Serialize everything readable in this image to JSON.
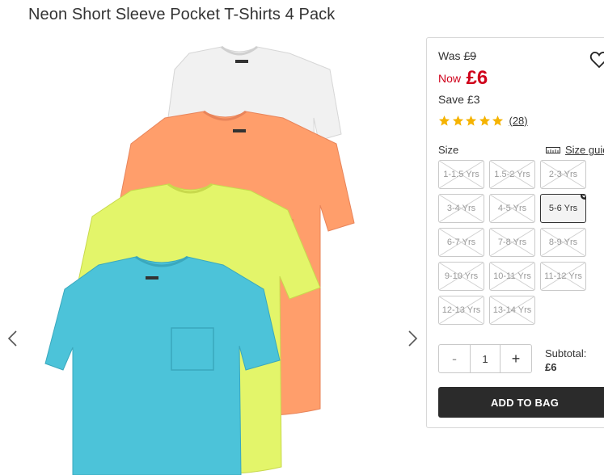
{
  "product": {
    "title": "Neon Short Sleeve Pocket T-Shirts 4 Pack"
  },
  "gallery": {
    "prev_icon": "chevron-left-icon",
    "next_icon": "chevron-right-icon",
    "shirt_colors": [
      "#f2f2f2",
      "#ff9e6b",
      "#e3f56a",
      "#4cc3d9"
    ]
  },
  "price": {
    "was_label": "Was",
    "was_value": "£9",
    "now_label": "Now",
    "now_value": "£6",
    "save_label": "Save",
    "save_value": "£3"
  },
  "rating": {
    "stars": 5,
    "count": "(28)"
  },
  "sizes": {
    "label": "Size",
    "guide_label": "Size guid",
    "options": [
      {
        "label": "1-1.5 Yrs",
        "available": false,
        "selected": false
      },
      {
        "label": "1.5-2 Yrs",
        "available": false,
        "selected": false
      },
      {
        "label": "2-3 Yrs",
        "available": false,
        "selected": false
      },
      {
        "label": "3-4 Yrs",
        "available": false,
        "selected": false
      },
      {
        "label": "4-5 Yrs",
        "available": false,
        "selected": false
      },
      {
        "label": "5-6 Yrs",
        "available": true,
        "selected": true
      },
      {
        "label": "6-7 Yrs",
        "available": false,
        "selected": false
      },
      {
        "label": "7-8 Yrs",
        "available": false,
        "selected": false
      },
      {
        "label": "8-9 Yrs",
        "available": false,
        "selected": false
      },
      {
        "label": "9-10 Yrs",
        "available": false,
        "selected": false
      },
      {
        "label": "10-11 Yrs",
        "available": false,
        "selected": false
      },
      {
        "label": "11-12 Yrs",
        "available": false,
        "selected": false
      },
      {
        "label": "12-13 Yrs",
        "available": false,
        "selected": false
      },
      {
        "label": "13-14 Yrs",
        "available": false,
        "selected": false
      }
    ]
  },
  "quantity": {
    "minus": "-",
    "value": "1",
    "plus": "+"
  },
  "subtotal": {
    "label": "Subtotal:",
    "value": "£6"
  },
  "cta": {
    "add_to_bag": "ADD TO BAG"
  },
  "colors": {
    "sale_red": "#d0021b",
    "star_gold": "#f5b301",
    "button_dark": "#2b2b2b"
  }
}
